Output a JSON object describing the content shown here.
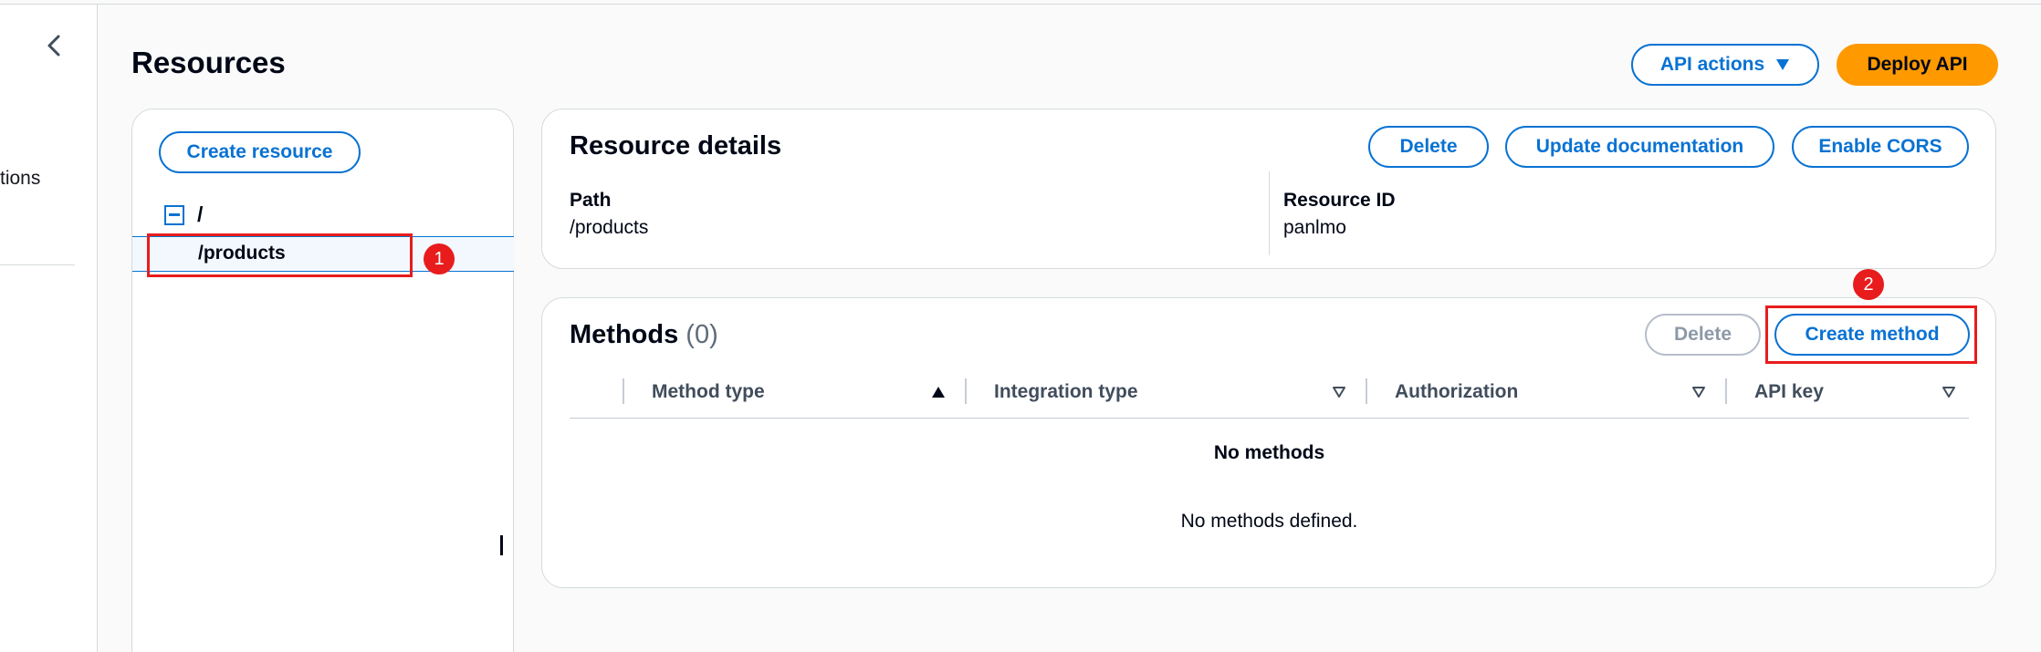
{
  "nav": {
    "collapse_icon": "chevron-left-icon",
    "cut_item_text": "tions"
  },
  "header": {
    "title": "Resources",
    "api_actions_label": "API actions",
    "api_actions_icon": "caret-down-icon",
    "deploy_label": "Deploy API"
  },
  "tree": {
    "create_resource_label": "Create resource",
    "root_icon": "collapse-minus-icon",
    "root_label": "/",
    "selected_item_label": "/products"
  },
  "details": {
    "title": "Resource details",
    "delete_label": "Delete",
    "update_docs_label": "Update documentation",
    "enable_cors_label": "Enable CORS",
    "path_label": "Path",
    "path_value": "/products",
    "resource_id_label": "Resource ID",
    "resource_id_value": "panlmo"
  },
  "methods": {
    "title": "Methods",
    "count": "(0)",
    "delete_label": "Delete",
    "create_method_label": "Create method",
    "columns": [
      {
        "label": "Method type",
        "sort_icon": "sort-ascending-icon"
      },
      {
        "label": "Integration type",
        "sort_icon": "sort-icon"
      },
      {
        "label": "Authorization",
        "sort_icon": "sort-icon"
      },
      {
        "label": "API key",
        "sort_icon": "sort-icon"
      }
    ],
    "empty_title": "No methods",
    "empty_message": "No methods defined."
  },
  "annotations": {
    "step1": "1",
    "step2": "2"
  },
  "colors": {
    "link_blue": "#0972d3",
    "primary_orange": "#ff9900",
    "annotation_red": "#e81c1c",
    "selected_bg": "#f2f8fd"
  }
}
